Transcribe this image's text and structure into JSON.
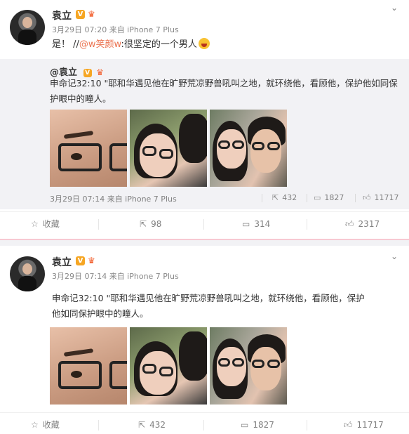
{
  "posts": [
    {
      "author": "袁立",
      "v_badge": "V",
      "meta": "3月29日 07:20 来自 iPhone 7 Plus",
      "text_prefix": "是！ //",
      "mention": "@w笑颜w",
      "text_suffix": ":很坚定的一个男人",
      "repost": {
        "author": "@袁立",
        "text": "申命记32:10 \"耶和华遇见他在旷野荒凉野兽吼叫之地，就环绕他，看顾他，保护他如同保护眼中的瞳人。",
        "meta": "3月29日 07:14 来自 iPhone 7 Plus",
        "reposts": "432",
        "comments": "1827",
        "likes": "11717"
      },
      "actions": {
        "favorite": "收藏",
        "reposts": "98",
        "comments": "314",
        "likes": "2317"
      }
    },
    {
      "author": "袁立",
      "v_badge": "V",
      "meta": "3月29日 07:14 来自 iPhone 7 Plus",
      "text_line1": "申命记32:10 \"耶和华遇见他在旷野荒凉野兽吼叫之地，就环绕他，看顾他，保护",
      "text_line2": "他如同保护眼中的瞳人。",
      "actions": {
        "favorite": "收藏",
        "reposts": "432",
        "comments": "1827",
        "likes": "11717"
      }
    }
  ],
  "icons": {
    "chevron": "chevron-down-icon",
    "star": "star-icon",
    "repost": "repost-icon",
    "comment": "comment-icon",
    "like": "thumbs-up-icon"
  },
  "colors": {
    "mention": "#eb7350",
    "v_badge": "#f6a623",
    "repost_bg": "#f2f2f5"
  }
}
